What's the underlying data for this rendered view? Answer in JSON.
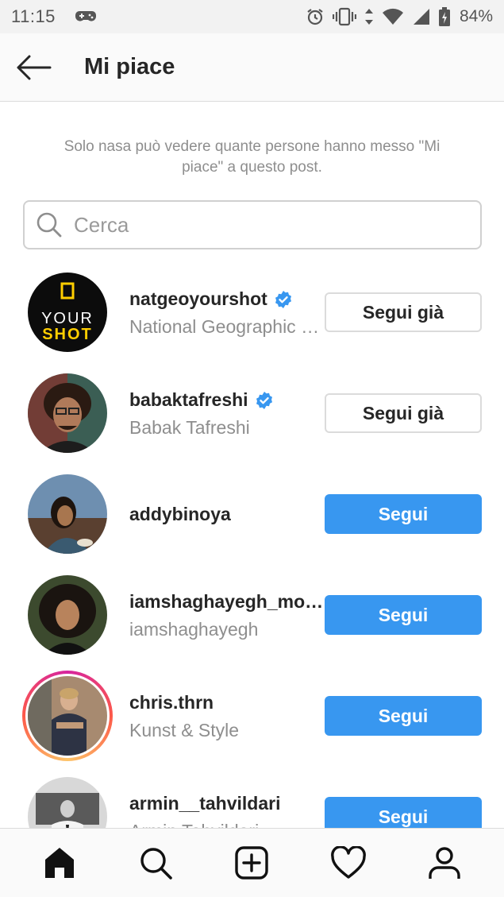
{
  "status_bar": {
    "time": "11:15",
    "battery": "84%",
    "icons": [
      "game-controller-icon",
      "alarm-icon",
      "vibrate-icon",
      "data-arrows-icon",
      "wifi-icon",
      "signal-icon",
      "battery-icon"
    ]
  },
  "header": {
    "title": "Mi piace",
    "back_icon": "arrow-left-icon"
  },
  "notice": "Solo nasa può vedere quante persone hanno messo \"Mi piace\" a questo post.",
  "search": {
    "placeholder": "Cerca",
    "icon": "search-icon"
  },
  "users": [
    {
      "username": "natgeoyourshot",
      "fullname": "National Geographic …",
      "verified": true,
      "button": "Segui già",
      "state": "following"
    },
    {
      "username": "babaktafreshi",
      "fullname": "Babak Tafreshi",
      "verified": true,
      "button": "Segui già",
      "state": "following"
    },
    {
      "username": "addybinoya",
      "fullname": "",
      "verified": false,
      "button": "Segui",
      "state": "follow"
    },
    {
      "username": "iamshaghayegh_mo…",
      "fullname": "iamshaghayegh",
      "verified": false,
      "button": "Segui",
      "state": "follow"
    },
    {
      "username": "chris.thrn",
      "fullname": "Kunst & Style",
      "verified": false,
      "button": "Segui",
      "state": "follow",
      "story_ring": true
    },
    {
      "username": "armin__tahvildari",
      "fullname": "Armin Tahvildari",
      "verified": false,
      "button": "Segui",
      "state": "follow"
    }
  ],
  "avatar_texts": {
    "natgeo_line1": "YOUR",
    "natgeo_line2": "SHOT"
  },
  "bottom_nav": [
    "home-icon",
    "search-icon",
    "add-post-icon",
    "heart-icon",
    "profile-icon"
  ],
  "colors": {
    "follow_blue": "#3897f0",
    "verified_blue": "#3897f0",
    "natgeo_yellow": "#ffce00"
  }
}
